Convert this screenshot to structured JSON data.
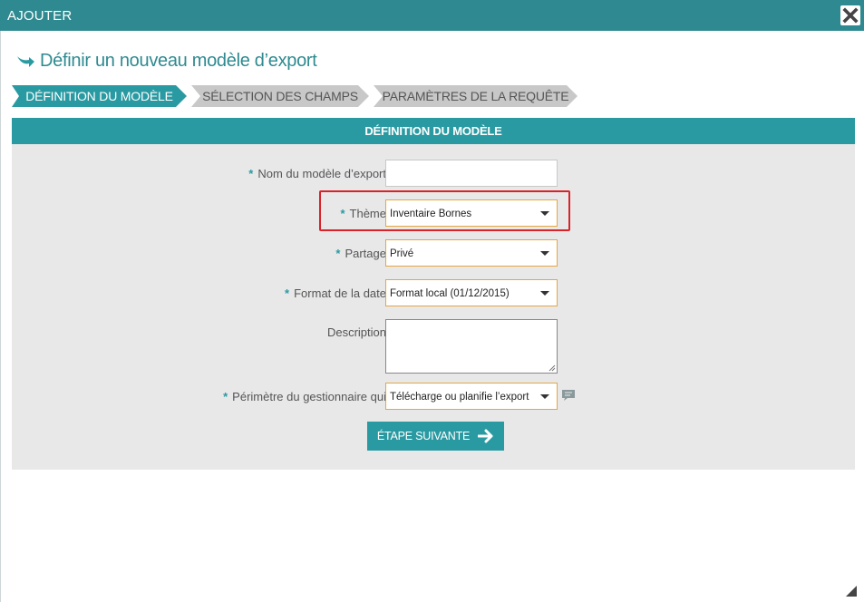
{
  "window": {
    "title": "AJOUTER",
    "close_icon": "close-icon"
  },
  "heading": {
    "icon": "arrow-right-icon",
    "text": "Définir un nouveau modèle d’export"
  },
  "steps": [
    {
      "label": "DÉFINITION DU MODÈLE",
      "active": true
    },
    {
      "label": "SÉLECTION DES CHAMPS",
      "active": false
    },
    {
      "label": "PARAMÈTRES DE LA REQUÊTE",
      "active": false
    }
  ],
  "panel": {
    "header": "DÉFINITION DU MODÈLE",
    "required_marker": "*",
    "fields": {
      "nom": {
        "label": "Nom du modèle d’export",
        "value": "",
        "required": true
      },
      "theme": {
        "label": "Thème",
        "value": "Inventaire Bornes",
        "required": true
      },
      "partage": {
        "label": "Partage",
        "value": "Privé",
        "required": true
      },
      "format_date": {
        "label": "Format de la date",
        "value": "Format local (01/12/2015)",
        "required": true
      },
      "description": {
        "label": "Description",
        "value": "",
        "required": false
      },
      "perimetre": {
        "label": "Périmètre du gestionnaire qui",
        "value": "Télécharge ou planifie l’export",
        "required": true
      }
    },
    "next_button": {
      "label": "ÉTAPE SUIVANTE",
      "icon": "arrow-right-icon"
    }
  },
  "colors": {
    "titlebar": "#2e8a90",
    "accent": "#2a9aa2",
    "step_inactive": "#c8c8c8",
    "panel_bg": "#e8e8e8",
    "select_border": "#e6a640",
    "highlight": "#d9232a"
  }
}
